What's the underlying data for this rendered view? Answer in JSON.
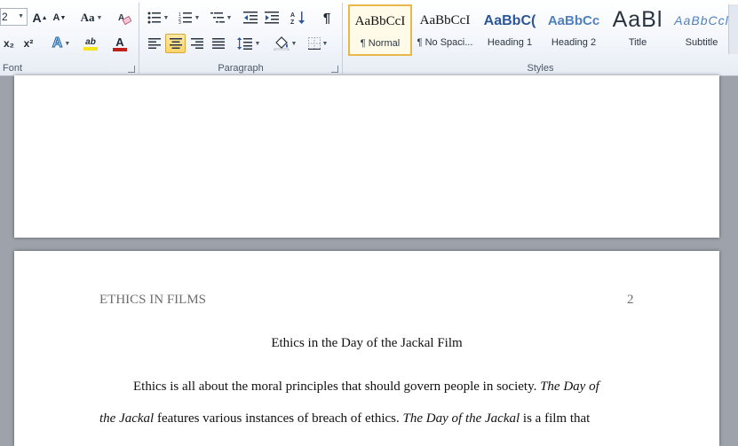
{
  "ribbon": {
    "font_group": {
      "label": "Font",
      "size_value": "2",
      "grow_label": "A",
      "shrink_label": "A",
      "case_label": "Aa",
      "subscript_label": "x₂",
      "superscript_label": "x²",
      "text_effect_label": "A",
      "highlight_label": "ab",
      "font_color_label": "A"
    },
    "paragraph_group": {
      "label": "Paragraph",
      "pilcrow": "¶"
    },
    "styles_group": {
      "label": "Styles",
      "items": [
        {
          "sample": "AaBbCcI",
          "name": "¶ Normal"
        },
        {
          "sample": "AaBbCcI",
          "name": "¶ No Spaci..."
        },
        {
          "sample": "AaBbC(",
          "name": "Heading 1"
        },
        {
          "sample": "AaBbCc",
          "name": "Heading 2"
        },
        {
          "sample": "AaBl",
          "name": "Title"
        },
        {
          "sample": "AaBbCcl",
          "name": "Subtitle"
        }
      ]
    },
    "colors": {
      "highlight": "#f7e51c",
      "font_color": "#c0201c",
      "accent": "#2b579a"
    }
  },
  "document": {
    "header_title": "ETHICS IN FILMS",
    "page_number": "2",
    "title": "Ethics in the Day of the Jackal Film",
    "para1_a": "Ethics is all about the moral principles that should govern people in society. ",
    "para1_b": "The Day of",
    "para2_a": "the Jackal",
    "para2_b": " features various instances of breach of ethics. ",
    "para2_c": "The Day of the Jackal",
    "para2_d": " is a film that"
  }
}
